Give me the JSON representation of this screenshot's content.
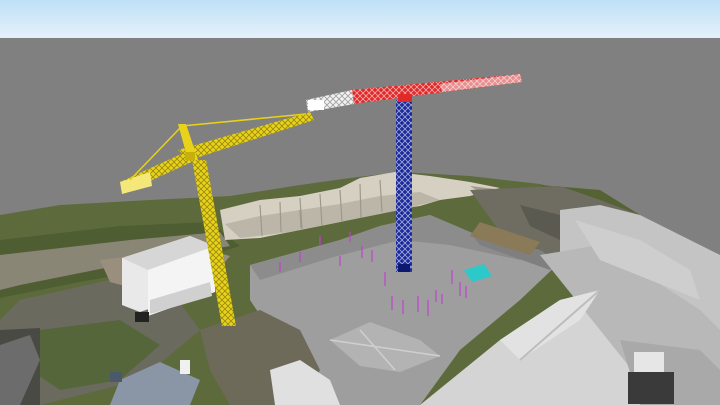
{
  "viewer": {
    "background_color": "#808080",
    "sky_color": "#cfe6f6"
  },
  "scene": {
    "objects": [
      {
        "name": "tower-crane-yellow",
        "color": "#e8d21a"
      },
      {
        "name": "tower-crane-blue-red",
        "mast_color": "#1b2a9a",
        "jib_color": "#e02a2a",
        "counter_jib_color": "#f0f0f0"
      },
      {
        "name": "excavation-pit",
        "color": "#9c9c9c"
      },
      {
        "name": "quarry-rock-face",
        "color": "#c8c2b6"
      },
      {
        "name": "terrain-mesh",
        "color": "#5f6f3a"
      },
      {
        "name": "bim-building-model",
        "color": "#c2c2c2"
      },
      {
        "name": "rebar-markers",
        "color": "#c040d0"
      },
      {
        "name": "teal-marker",
        "color": "#2bc9c9"
      }
    ]
  }
}
